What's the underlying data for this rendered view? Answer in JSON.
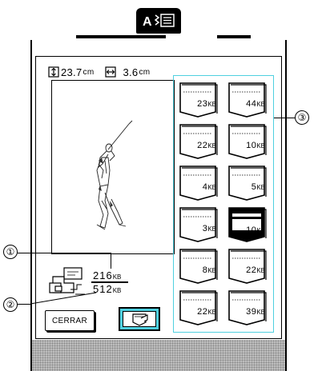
{
  "mode_icon": {
    "name": "embroidery-edit-mode-icon",
    "label": "A"
  },
  "dimensions": {
    "height_value": "23.7",
    "height_unit": "cm",
    "width_value": "3.6",
    "width_unit": "cm"
  },
  "memory": {
    "used_value": "216",
    "used_unit": "KB",
    "total_value": "512",
    "total_unit": "KB"
  },
  "callouts": [
    "①",
    "②",
    "③"
  ],
  "buttons": {
    "close_label": "CERRAR",
    "save_icon": "pocket-save-icon"
  },
  "pockets": [
    {
      "value": "23",
      "unit": "KB",
      "selected": false
    },
    {
      "value": "44",
      "unit": "KB",
      "selected": false
    },
    {
      "value": "22",
      "unit": "KB",
      "selected": false
    },
    {
      "value": "10",
      "unit": "KB",
      "selected": false
    },
    {
      "value": "4",
      "unit": "KB",
      "selected": false
    },
    {
      "value": "5",
      "unit": "KB",
      "selected": false
    },
    {
      "value": "3",
      "unit": "KB",
      "selected": false
    },
    {
      "value": "10",
      "unit": "KB",
      "selected": true
    },
    {
      "value": "8",
      "unit": "KB",
      "selected": false
    },
    {
      "value": "22",
      "unit": "KB",
      "selected": false
    },
    {
      "value": "22",
      "unit": "KB",
      "selected": false
    },
    {
      "value": "39",
      "unit": "KB",
      "selected": false
    }
  ],
  "colors": {
    "accent": "#4fd0e0",
    "pocket_fill": "#ffffff",
    "selected_fill": "#000000"
  }
}
